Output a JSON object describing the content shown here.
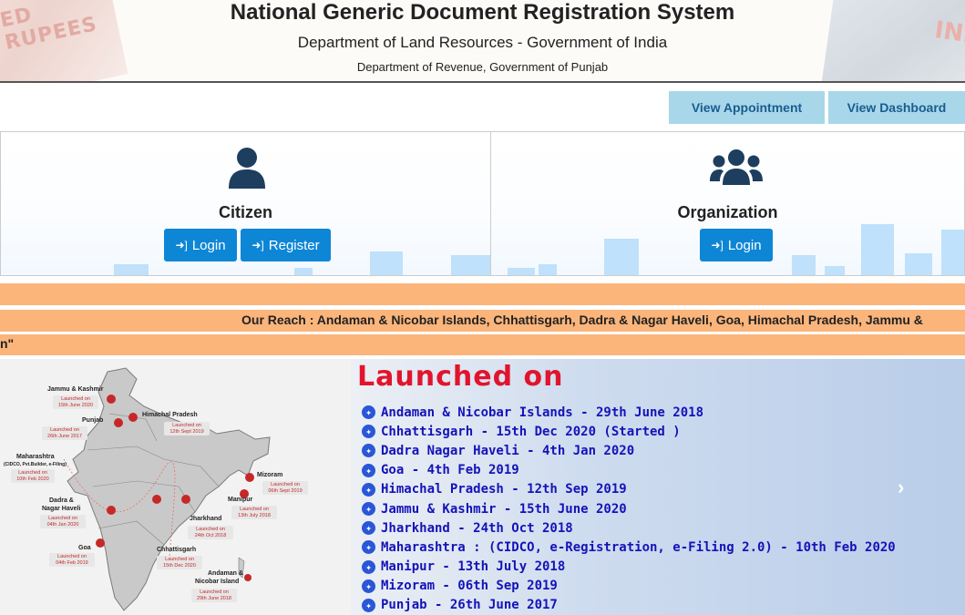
{
  "header": {
    "title": "National Generic Document Registration System",
    "subtitle": "Department of Land Resources - Government of India",
    "department": "Department of Revenue, Government of Punjab",
    "banner_left_text": "ED RUPEES",
    "banner_right_text": "IND"
  },
  "top_buttons": {
    "view_appointment": "View Appointment",
    "view_dashboard": "View Dashboard"
  },
  "citizen": {
    "label": "Citizen",
    "login": "Login",
    "register": "Register"
  },
  "organization": {
    "label": "Organization",
    "login": "Login"
  },
  "marquee": {
    "reach_text": "Our Reach : Andaman & Nicobar Islands,  Chhattisgarh, Dadra & Nagar Haveli, Goa, Himachal Pradesh, Jammu &",
    "strip3_text": "n\""
  },
  "launch": {
    "title": "Launched on",
    "items": [
      "Andaman & Nicobar Islands - 29th June 2018",
      "Chhattisgarh - 15th Dec 2020 (Started )",
      "Dadra Nagar Haveli - 4th Jan 2020",
      "Goa - 4th Feb 2019",
      "Himachal Pradesh - 12th Sep 2019",
      "Jammu & Kashmir - 15th June 2020",
      "Jharkhand - 24th Oct 2018",
      "Maharashtra : (CIDCO, e-Registration, e-Filing 2.0) - 10th Feb 2020",
      "Manipur - 13th July 2018",
      "Mizoram - 06th Sep 2019",
      "Punjab - 26th June 2017"
    ]
  },
  "map": {
    "labels": {
      "jk": "Jammu & Kashmir",
      "punjab": "Punjab",
      "hp": "Himachal Pradesh",
      "maharashtra": "Maharashtra",
      "maharashtra_sub": "(CIDCO, Pvt.Builder, e-Filing)",
      "dadra": "Dadra &",
      "dadra2": "Nagar Haveli",
      "goa": "Goa",
      "chhattisgarh": "Chhattisgarh",
      "jharkhand": "Jharkhand",
      "mizoram": "Mizoram",
      "manipur": "Manipur",
      "andaman": "Andaman &",
      "andaman2": "Nicobar Island"
    },
    "notes": {
      "jk": "Launched on 15th June 2020",
      "punjab": "Launched on 26th June 2017",
      "hp": "Launched on 12th Sept 2019",
      "maharashtra": "Launched on 10th Feb 2020",
      "dadra": "Launched on 04th Jan 2020",
      "goa": "Launched on 04th Feb 2019",
      "chhattisgarh": "Launched on 15th Dec 2020",
      "jharkhand": "Launched on 24th Oct 2018",
      "mizoram": "Launched on 06th Sept 2019",
      "manipur": "Launched on 13th July 2018",
      "andaman": "Launched on 29th June 2018"
    }
  },
  "colors": {
    "primary_button": "#0d86d6",
    "light_button": "#a9d7ea",
    "strip": "#fbb57b",
    "launch_title": "#e2142d",
    "launch_text": "#1413b8"
  }
}
